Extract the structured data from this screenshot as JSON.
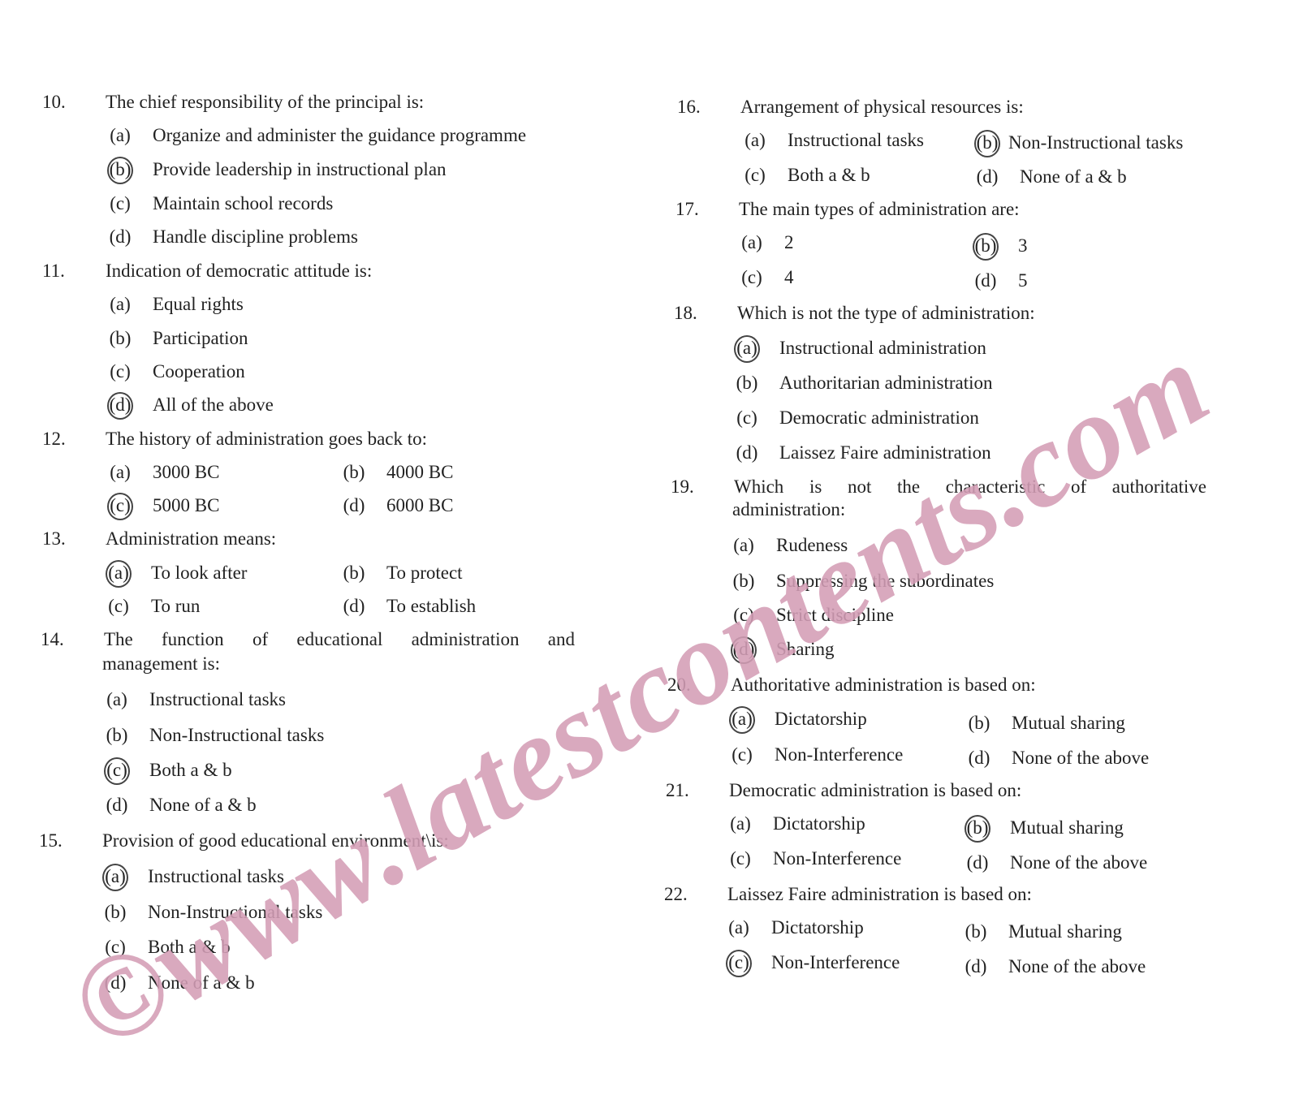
{
  "watermark": {
    "text": "©www.latestcontents.com",
    "color": "#d49eb6"
  },
  "questions": [
    {
      "number": "10.",
      "text": "The chief responsibility of the principal is:",
      "options": [
        {
          "label": "(a)",
          "text": "Organize and administer the guidance programme",
          "marked": false
        },
        {
          "label": "(b)",
          "text": "Provide leadership in instructional plan",
          "marked": true
        },
        {
          "label": "(c)",
          "text": "Maintain school records",
          "marked": false
        },
        {
          "label": "(d)",
          "text": "Handle discipline problems",
          "marked": false
        }
      ]
    },
    {
      "number": "11.",
      "text": "Indication of democratic attitude is:",
      "options": [
        {
          "label": "(a)",
          "text": "Equal rights",
          "marked": false
        },
        {
          "label": "(b)",
          "text": "Participation",
          "marked": false
        },
        {
          "label": "(c)",
          "text": "Cooperation",
          "marked": false
        },
        {
          "label": "(d)",
          "text": "All of the above",
          "marked": true
        }
      ]
    },
    {
      "number": "12.",
      "text": "The history of administration goes back to:",
      "options": [
        {
          "label": "(a)",
          "text": "3000 BC",
          "marked": false
        },
        {
          "label": "(b)",
          "text": "4000 BC",
          "marked": false
        },
        {
          "label": "(c)",
          "text": "5000 BC",
          "marked": true
        },
        {
          "label": "(d)",
          "text": "6000 BC",
          "marked": false
        }
      ]
    },
    {
      "number": "13.",
      "text": "Administration means:",
      "options": [
        {
          "label": "(a)",
          "text": "To look after",
          "marked": true
        },
        {
          "label": "(b)",
          "text": "To protect",
          "marked": false
        },
        {
          "label": "(c)",
          "text": "To run",
          "marked": false
        },
        {
          "label": "(d)",
          "text": "To establish",
          "marked": false
        }
      ]
    },
    {
      "number": "14.",
      "text": "The function of educational administration and",
      "text_cont": "management is:",
      "options": [
        {
          "label": "(a)",
          "text": "Instructional tasks",
          "marked": false
        },
        {
          "label": "(b)",
          "text": "Non-Instructional tasks",
          "marked": false
        },
        {
          "label": "(c)",
          "text": "Both a & b",
          "marked": true
        },
        {
          "label": "(d)",
          "text": "None of a & b",
          "marked": false
        }
      ]
    },
    {
      "number": "15.",
      "text": "Provision of good educational environment\\is:",
      "options": [
        {
          "label": "(a)",
          "text": "Instructional tasks",
          "marked": true
        },
        {
          "label": "(b)",
          "text": "Non-Instructional tasks",
          "marked": false
        },
        {
          "label": "(c)",
          "text": "Both a & b",
          "marked": false
        },
        {
          "label": "(d)",
          "text": "None of a & b",
          "marked": false
        }
      ]
    },
    {
      "number": "16.",
      "text": "Arrangement of physical resources is:",
      "options": [
        {
          "label": "(a)",
          "text": "Instructional tasks",
          "marked": false
        },
        {
          "label": "(b)",
          "text": "Non-Instructional tasks",
          "marked": true
        },
        {
          "label": "(c)",
          "text": "Both a & b",
          "marked": false
        },
        {
          "label": "(d)",
          "text": "None of a & b",
          "marked": false
        }
      ]
    },
    {
      "number": "17.",
      "text": "The main types of administration are:",
      "options": [
        {
          "label": "(a)",
          "text": "2",
          "marked": false
        },
        {
          "label": "(b)",
          "text": "3",
          "marked": true
        },
        {
          "label": "(c)",
          "text": "4",
          "marked": false
        },
        {
          "label": "(d)",
          "text": "5",
          "marked": false
        }
      ]
    },
    {
      "number": "18.",
      "text": "Which is not the type of administration:",
      "options": [
        {
          "label": "(a)",
          "text": "Instructional administration",
          "marked": true
        },
        {
          "label": "(b)",
          "text": "Authoritarian administration",
          "marked": false
        },
        {
          "label": "(c)",
          "text": "Democratic administration",
          "marked": false
        },
        {
          "label": "(d)",
          "text": "Laissez Faire administration",
          "marked": false
        }
      ]
    },
    {
      "number": "19.",
      "text": "Which is not the characteristic of authoritative",
      "text_cont": "administration:",
      "options": [
        {
          "label": "(a)",
          "text": "Rudeness",
          "marked": false
        },
        {
          "label": "(b)",
          "text": "Suppressing the subordinates",
          "marked": false
        },
        {
          "label": "(c)",
          "text": "Strict discipline",
          "marked": false
        },
        {
          "label": "(d)",
          "text": "Sharing",
          "marked": true
        }
      ]
    },
    {
      "number": "20.",
      "text": "Authoritative administration is based on:",
      "options": [
        {
          "label": "(a)",
          "text": "Dictatorship",
          "marked": true
        },
        {
          "label": "(b)",
          "text": "Mutual sharing",
          "marked": false
        },
        {
          "label": "(c)",
          "text": "Non-Interference",
          "marked": false
        },
        {
          "label": "(d)",
          "text": "None of the above",
          "marked": false
        }
      ]
    },
    {
      "number": "21.",
      "text": "Democratic administration is based on:",
      "options": [
        {
          "label": "(a)",
          "text": "Dictatorship",
          "marked": false
        },
        {
          "label": "(b)",
          "text": "Mutual sharing",
          "marked": true
        },
        {
          "label": "(c)",
          "text": "Non-Interference",
          "marked": false
        },
        {
          "label": "(d)",
          "text": "None of the above",
          "marked": false
        }
      ]
    },
    {
      "number": "22.",
      "text": "Laissez Faire administration is based on:",
      "options": [
        {
          "label": "(a)",
          "text": "Dictatorship",
          "marked": false
        },
        {
          "label": "(b)",
          "text": "Mutual sharing",
          "marked": false
        },
        {
          "label": "(c)",
          "text": "Non-Interference",
          "marked": true
        },
        {
          "label": "(d)",
          "text": "None of the above",
          "marked": false
        }
      ]
    }
  ]
}
